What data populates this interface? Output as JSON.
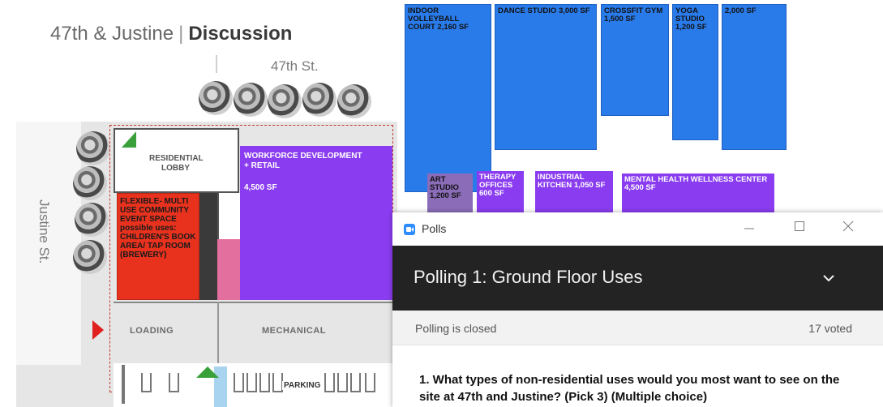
{
  "slide": {
    "title_prefix": "47th & Justine",
    "title_sep": "|",
    "title_bold": "Discussion",
    "street_top": "47th St.",
    "street_left": "Justine St.",
    "labels": {
      "residential": "RESIDENTIAL",
      "lobby": "LOBBY",
      "workforce": "WORKFORCE DEVELOPMENT",
      "workforce2": "+ RETAIL",
      "workforce_sf": "4,500 SF",
      "flex": "FLEXIBLE- MULTI USE COMMUNITY EVENT SPACE possible uses: CHILDREN'S BOOK AREA/ TAP ROOM (BREWERY)",
      "loading": "LOADING",
      "mechanical": "MECHANICAL",
      "parking": "PARKING"
    },
    "colors": {
      "workforce": "#8a3df0",
      "flex": "#e8321e",
      "pink": "#e36f9f",
      "arrow_green": "#3aa13a",
      "arrow_red": "#e01f1f"
    }
  },
  "blocks_blue": [
    {
      "label": "INDOOR VOLLEYBALL COURT 2,160 SF"
    },
    {
      "label": "DANCE STUDIO 3,000 SF"
    },
    {
      "label": "CROSSFIT GYM 1,500 SF"
    },
    {
      "label": "YOGA STUDIO 1,200 SF"
    },
    {
      "label": "2,000 SF"
    }
  ],
  "blocks_purple": [
    {
      "label": "ART STUDIO 1,200 SF"
    },
    {
      "label": "THERAPY OFFICES 600 SF"
    },
    {
      "label": "INDUSTRIAL KITCHEN 1,050 SF"
    },
    {
      "label": "MENTAL HEALTH WELLNESS CENTER 4,500 SF"
    }
  ],
  "polls": {
    "window_title": "Polls",
    "poll_title": "Polling 1: Ground Floor Uses",
    "status": "Polling is closed",
    "voted": "17 voted",
    "question": "1. What types of non-residential uses would you most want to see on the site at 47th and Justine? (Pick 3) (Multiple choice)",
    "icons": {
      "minimize": "minimize-icon",
      "maximize": "maximize-icon",
      "close": "close-icon",
      "expand": "chevron-down-icon"
    }
  }
}
